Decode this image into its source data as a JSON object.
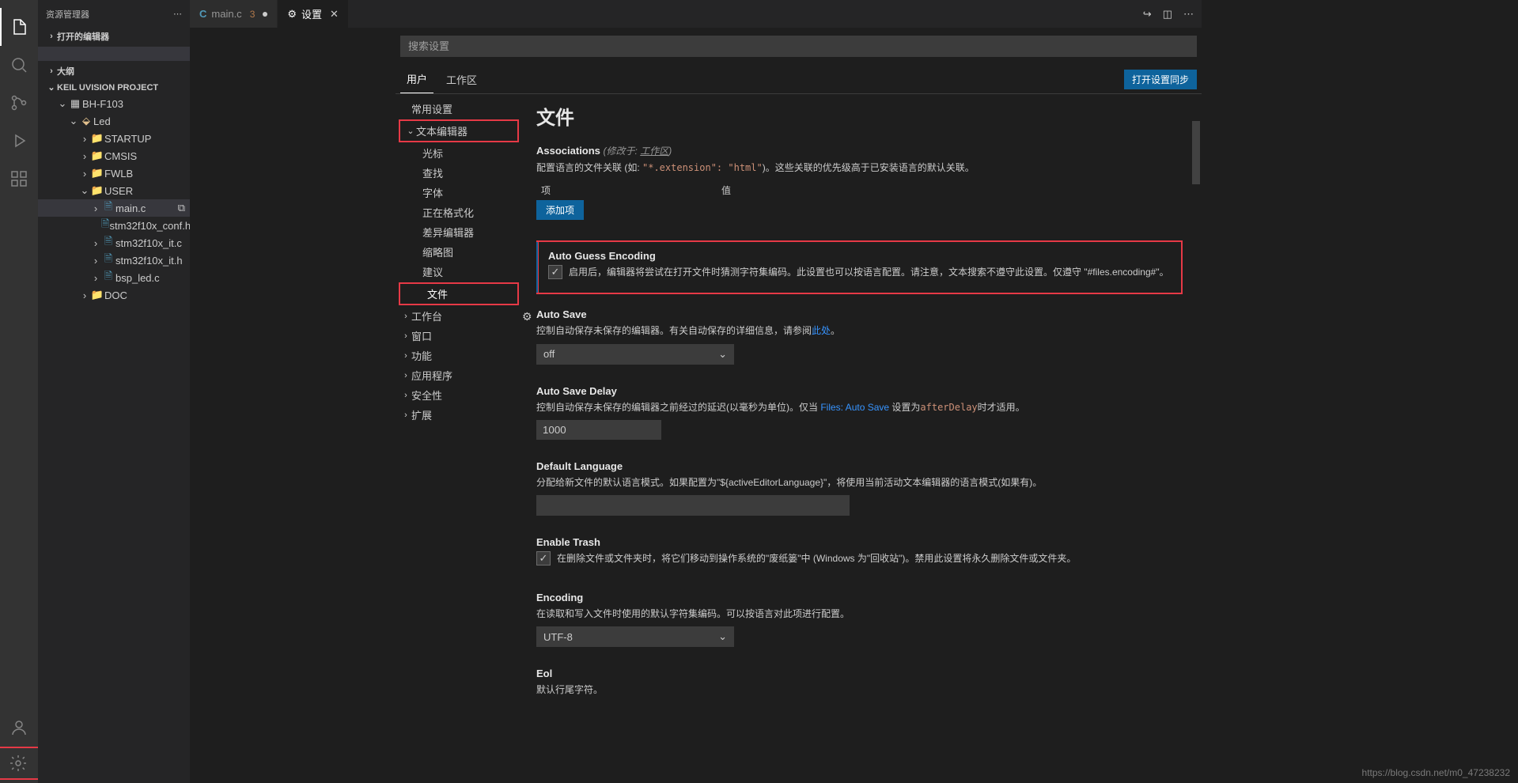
{
  "sidebar": {
    "title": "资源管理器",
    "sections": {
      "open_editors": "打开的编辑器",
      "outline": "大纲",
      "project": "KEIL UVISION PROJECT"
    },
    "tree": {
      "root": "BH-F103",
      "led": "Led",
      "startup": "STARTUP",
      "cmsis": "CMSIS",
      "fwlb": "FWLB",
      "user": "USER",
      "main_c": "main.c",
      "conf_h": "stm32f10x_conf.h",
      "it_c": "stm32f10x_it.c",
      "it_h": "stm32f10x_it.h",
      "bsp_led_c": "bsp_led.c",
      "doc": "DOC"
    }
  },
  "tabs": {
    "main_c": "main.c",
    "main_c_badge": "3",
    "settings": "设置"
  },
  "search_placeholder": "搜索设置",
  "scope": {
    "user": "用户",
    "workspace": "工作区",
    "sync": "打开设置同步"
  },
  "toc": {
    "common": "常用设置",
    "text_editor": "文本编辑器",
    "cursor": "光标",
    "find": "查找",
    "font": "字体",
    "formatting": "正在格式化",
    "diff": "差异编辑器",
    "minimap": "缩略图",
    "suggest": "建议",
    "files": "文件",
    "workbench": "工作台",
    "window": "窗口",
    "features": "功能",
    "application": "应用程序",
    "security": "安全性",
    "extensions": "扩展"
  },
  "content": {
    "heading": "文件",
    "associations": {
      "title": "Associations",
      "scope": "(修改于: ",
      "scope_u": "工作区",
      "scope_end": ")",
      "desc_pre": "配置语言的文件关联 (如: ",
      "desc_code": "\"*.extension\": \"html\"",
      "desc_post": ")。这些关联的优先级高于已安装语言的默认关联。",
      "col1": "项",
      "col2": "值",
      "add": "添加项"
    },
    "auto_guess": {
      "title": "Auto Guess Encoding",
      "desc": "启用后，编辑器将尝试在打开文件时猜测字符集编码。此设置也可以按语言配置。请注意，文本搜索不遵守此设置。仅遵守 \"#files.encoding#\"。"
    },
    "auto_save": {
      "title": "Auto Save",
      "desc_pre": "控制自动保存未保存的编辑器。有关自动保存的详细信息，请参阅",
      "link": "此处",
      "desc_post": "。",
      "value": "off"
    },
    "auto_save_delay": {
      "title": "Auto Save Delay",
      "desc_pre": "控制自动保存未保存的编辑器之前经过的延迟(以毫秒为单位)。仅当 ",
      "link": "Files: Auto Save",
      "desc_mid": " 设置为",
      "code": "afterDelay",
      "desc_post": "时才适用。",
      "value": "1000"
    },
    "default_language": {
      "title": "Default Language",
      "desc": "分配给新文件的默认语言模式。如果配置为\"${activeEditorLanguage}\"，将使用当前活动文本编辑器的语言模式(如果有)。"
    },
    "enable_trash": {
      "title": "Enable Trash",
      "desc": "在删除文件或文件夹时，将它们移动到操作系统的\"废纸篓\"中 (Windows 为\"回收站\")。禁用此设置将永久删除文件或文件夹。"
    },
    "encoding": {
      "title": "Encoding",
      "desc": "在读取和写入文件时使用的默认字符集编码。可以按语言对此项进行配置。",
      "value": "UTF-8"
    },
    "eol": {
      "title": "Eol",
      "desc": "默认行尾字符。"
    }
  },
  "watermark": "https://blog.csdn.net/m0_47238232"
}
